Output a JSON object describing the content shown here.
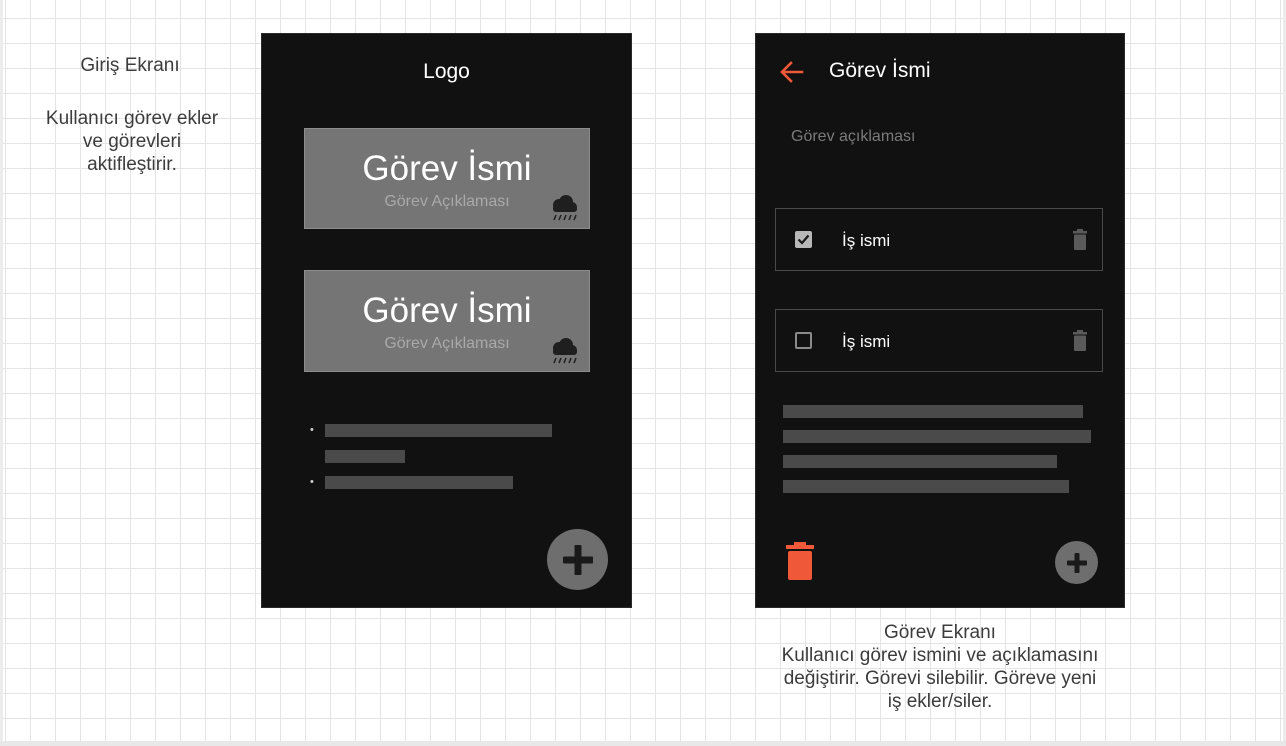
{
  "notes": {
    "home_title": "Giriş Ekranı",
    "home_desc_lines": [
      "Kullanıcı görev ekler",
      "ve görevleri",
      "aktifleştirir."
    ],
    "task_title": "Görev Ekranı",
    "task_desc_lines": [
      "Kullanıcı görev ismini ve açıklamasını",
      "değiştirir. Görevi silebilir. Göreve yeni",
      "iş ekler/siler."
    ]
  },
  "home_screen": {
    "logo": "Logo",
    "cards": [
      {
        "title": "Görev İsmi",
        "description": "Görev Açıklaması",
        "icon": "rain-cloud-icon"
      },
      {
        "title": "Görev İsmi",
        "description": "Görev Açıklaması",
        "icon": "rain-cloud-icon"
      }
    ],
    "fab_icon": "plus-icon"
  },
  "task_screen": {
    "back_icon": "arrow-left-icon",
    "title": "Görev İsmi",
    "description": "Görev açıklaması",
    "tasks": [
      {
        "label": "İş ismi",
        "checked": true,
        "icon": "trash-icon"
      },
      {
        "label": "İş ismi",
        "checked": false,
        "icon": "trash-icon"
      }
    ],
    "delete_icon": "trash-icon",
    "add_icon": "plus-icon"
  },
  "colors": {
    "screen_bg": "#111111",
    "card_bg": "#757575",
    "accent": "#f0583a",
    "placeholder_bar": "#4a4a4a"
  }
}
